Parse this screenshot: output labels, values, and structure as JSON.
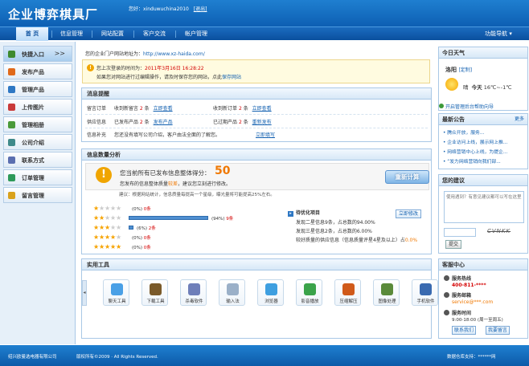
{
  "header": {
    "logo": "企业博弈棋具厂",
    "greeting": "您好：xinduwuchina2010  ",
    "exit_label": "[退出]"
  },
  "nav": {
    "items": [
      "首 页",
      "信息管理",
      "网站配置",
      "客户交流",
      "帐户管理"
    ],
    "right_label": "功能导航 ▾"
  },
  "sidebar": {
    "quick_label": "快捷入口",
    "quick_arrow": ">>",
    "items": [
      "发布产品",
      "管理产品",
      "上传图片",
      "管理相册",
      "公司介绍",
      "联系方式",
      "订单管理",
      "留言管理"
    ]
  },
  "colors": {
    "primary": "#1f7fd0",
    "accent_orange": "#f07800",
    "alert_red": "#d40000",
    "link_blue": "#1260b0"
  },
  "main": {
    "url_prefix": "您的企业门户网站地址为：",
    "url": "http://www.xz-haida.com/",
    "notice": {
      "line1_prefix": "您上次登录的时间为：",
      "line1_time": "2011年3月16日 16:28:22",
      "line2": "如果您对网站进行过编辑操作，请及时保存您的网站，点此",
      "line2_link": "保存网站"
    },
    "messages": {
      "title": "消息提醒",
      "rows": [
        {
          "label": "留言订单",
          "a": "收到新留言",
          "a_num": "2",
          "a_unit": "条",
          "a_link": "立即查看",
          "b": "收到新订单",
          "b_num": "2",
          "b_unit": "条",
          "b_link": "立即查看"
        },
        {
          "label": "供应信息",
          "a": "已发布产品",
          "a_num": "2",
          "a_unit": "条",
          "a_link": "发布产品",
          "b": "已过期产品",
          "b_num": "2",
          "b_unit": "条",
          "b_link": "重新发布"
        },
        {
          "label": "信息补充",
          "a": "您还没有填写公司介绍，客户由法全面的了解您。",
          "a_link": "立即填写"
        }
      ]
    },
    "analysis": {
      "title": "信息数量分析",
      "score_text": "您当前所有已发布信息整体得分：",
      "score": "50",
      "line2_prefix": "您发布的信息整体质量",
      "line2_level": "较差",
      "line2_suffix": "，建议您立刻进行修改。",
      "recalc_label": "重新计算",
      "note": "建议：根据网站统计，信息质量每提高一个星级，曝光量将可能提高25%左右。",
      "stars": [
        {
          "stars": 1,
          "percent": 0,
          "pct_label": "(0%)",
          "count": "0条"
        },
        {
          "stars": 2,
          "percent": 94,
          "pct_label": "(94%)",
          "count": "9条"
        },
        {
          "stars": 3,
          "percent": 6,
          "pct_label": "(6%)",
          "count": "2条"
        },
        {
          "stars": 4,
          "percent": 0,
          "pct_label": "(0%)",
          "count": "0条"
        },
        {
          "stars": 5,
          "percent": 0,
          "pct_label": "(0%)",
          "count": "0条"
        }
      ],
      "optimize_title": "待优化项目",
      "fix_label": "立即修改",
      "opt_lines": [
        {
          "text": "发现二星信息9条，占总数的94.00%"
        },
        {
          "text": "发现三星信息2条，占总数的6.00%"
        },
        {
          "text": "较好质量的供应信息（信息质量评星4星及以上）占",
          "pct": "0.0%"
        }
      ]
    },
    "tools": {
      "title": "实用工具",
      "items": [
        "聊天工具",
        "下载工具",
        "杀毒软件",
        "输入法",
        "浏览器",
        "影音播放",
        "压缩解压",
        "图像处理",
        "手机软件"
      ],
      "icons": [
        "qq-icon",
        "download-icon",
        "antivirus-icon",
        "input-method-icon",
        "browser-icon",
        "media-player-icon",
        "compress-icon",
        "image-icon",
        "mobile-icon"
      ]
    }
  },
  "weather": {
    "title": "今日天气",
    "city": "洛阳",
    "customize": "[定制]",
    "condition": "晴",
    "today_label": "今天",
    "temp": "16℃~-1℃",
    "help": "开启管理后台帮助向导"
  },
  "announcements": {
    "title": "最新公告",
    "more": "更多",
    "items": [
      "腾众开放，服务...",
      "企业访问上线，展示网上推...",
      "网络营销中心上线，为提企...",
      "“发力网络营销向我们部..."
    ]
  },
  "suggestion": {
    "title": "您的建议",
    "placeholder": "使用遇到？有意见建议都可以写在这里",
    "captcha": "CVNKK",
    "submit": "提交"
  },
  "service": {
    "title": "客服中心",
    "hotline_label": "服务热线",
    "hotline": "400-811-****",
    "email_label": "服务邮箱",
    "email": "service@***.com",
    "hours_label": "服务时间",
    "hours": "9:00-18:00 (周一至周五)",
    "contact_btn": "联系我们",
    "msg_btn": "我要留言"
  },
  "footer": {
    "company": "绍兴欧曼选电器有限公司",
    "copyright": "版权所有©2009 · All Rights Reserved.",
    "support": "数据仓库支持：******网"
  }
}
